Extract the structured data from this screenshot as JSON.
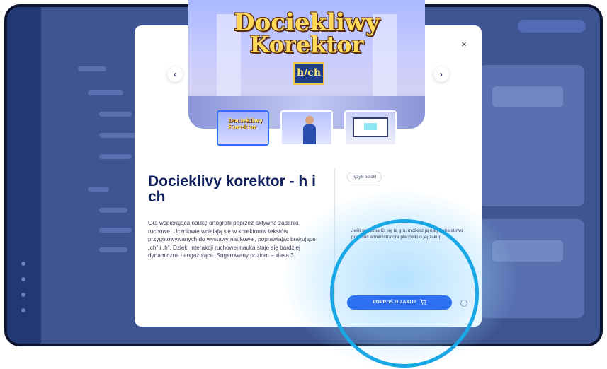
{
  "modal": {
    "game_title": "Docieklivy korektor - h i ch",
    "description": "Gra wspierająca naukę ortografii poprzez aktywne zadania ruchowe. Uczniowie wcielają się w korektorów tekstów przygotowywanych do wystawy naukowej, poprawiając brakujące „ch” i „h”. Dzięki interakcji ruchowej nauka staje się bardziej dynamiczna i angażująca. Sugerowany poziom – klasa 3.",
    "language_tag": "język polski",
    "info_text": "Jeśli spodoba Ci się ta gra, możesz ją natychmiastowo poprosić administratora placówki o jej zakup.",
    "request_button_label": "POPROŚ O ZAKUP",
    "close_label": "×",
    "prev_label": "‹",
    "next_label": "›",
    "hero_logo": {
      "line1": "Dociekliwy",
      "line2": "Korektor",
      "badge": "h/ch"
    },
    "thumbnails": [
      {
        "name": "thumb-logo"
      },
      {
        "name": "thumb-character"
      },
      {
        "name": "thumb-screen"
      }
    ]
  },
  "colors": {
    "accent": "#2d71f0",
    "title": "#0f1f5c",
    "overlay": "#3f5592",
    "ring": "#1aa7e6"
  },
  "icons": [
    "close-icon",
    "chevron-left-icon",
    "chevron-right-icon",
    "cart-icon",
    "info-icon"
  ]
}
